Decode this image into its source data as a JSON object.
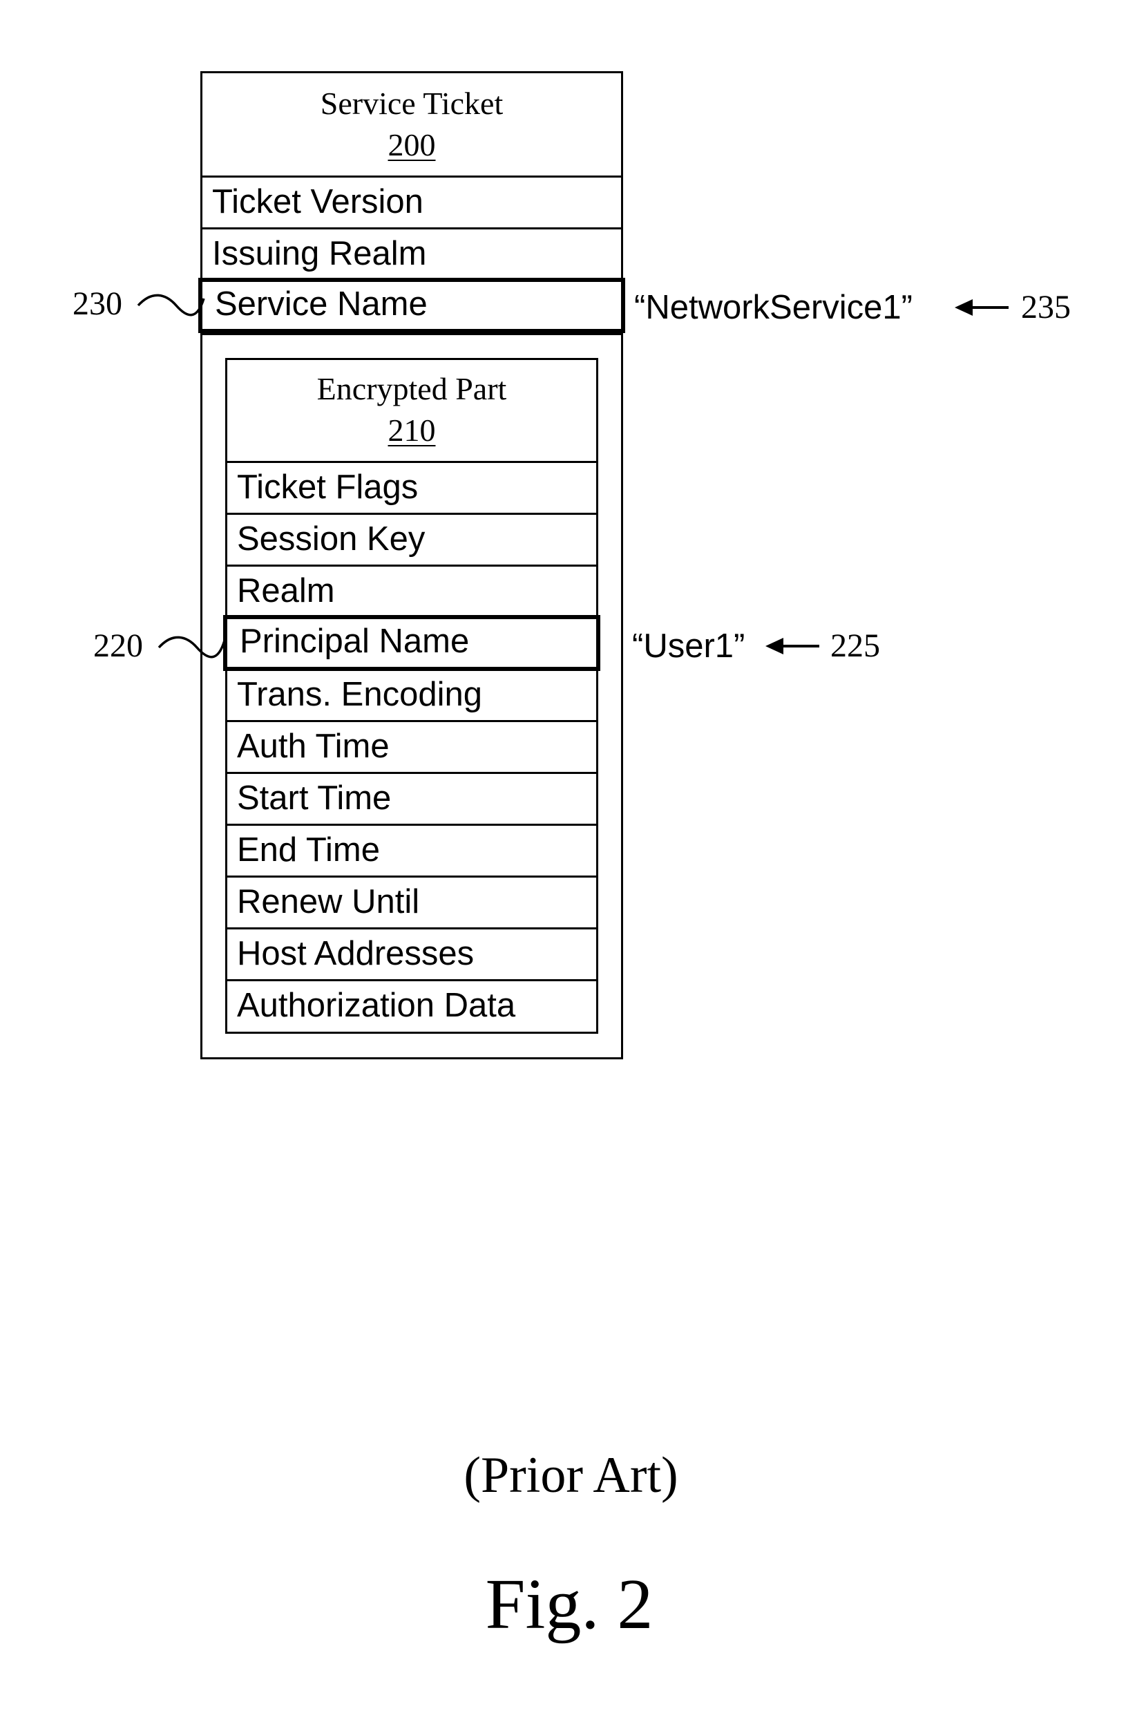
{
  "service_ticket": {
    "title": "Service Ticket",
    "ref": "200",
    "fields": [
      {
        "label": "Ticket Version",
        "highlighted": false
      },
      {
        "label": "Issuing Realm",
        "highlighted": false
      },
      {
        "label": "Service Name",
        "highlighted": true,
        "ref": "230",
        "value": "“NetworkService1”",
        "value_ref": "235"
      }
    ]
  },
  "encrypted_part": {
    "title": "Encrypted Part",
    "ref": "210",
    "fields": [
      {
        "label": "Ticket Flags",
        "highlighted": false
      },
      {
        "label": "Session Key",
        "highlighted": false
      },
      {
        "label": "Realm",
        "highlighted": false
      },
      {
        "label": "Principal Name",
        "highlighted": true,
        "ref": "220",
        "value": "“User1”",
        "value_ref": "225"
      },
      {
        "label": "Trans. Encoding",
        "highlighted": false
      },
      {
        "label": "Auth Time",
        "highlighted": false
      },
      {
        "label": "Start Time",
        "highlighted": false
      },
      {
        "label": "End Time",
        "highlighted": false
      },
      {
        "label": "Renew Until",
        "highlighted": false
      },
      {
        "label": "Host Addresses",
        "highlighted": false
      },
      {
        "label": "Authorization Data",
        "highlighted": false
      }
    ]
  },
  "caption": "(Prior Art)",
  "figure_label": "Fig. 2"
}
